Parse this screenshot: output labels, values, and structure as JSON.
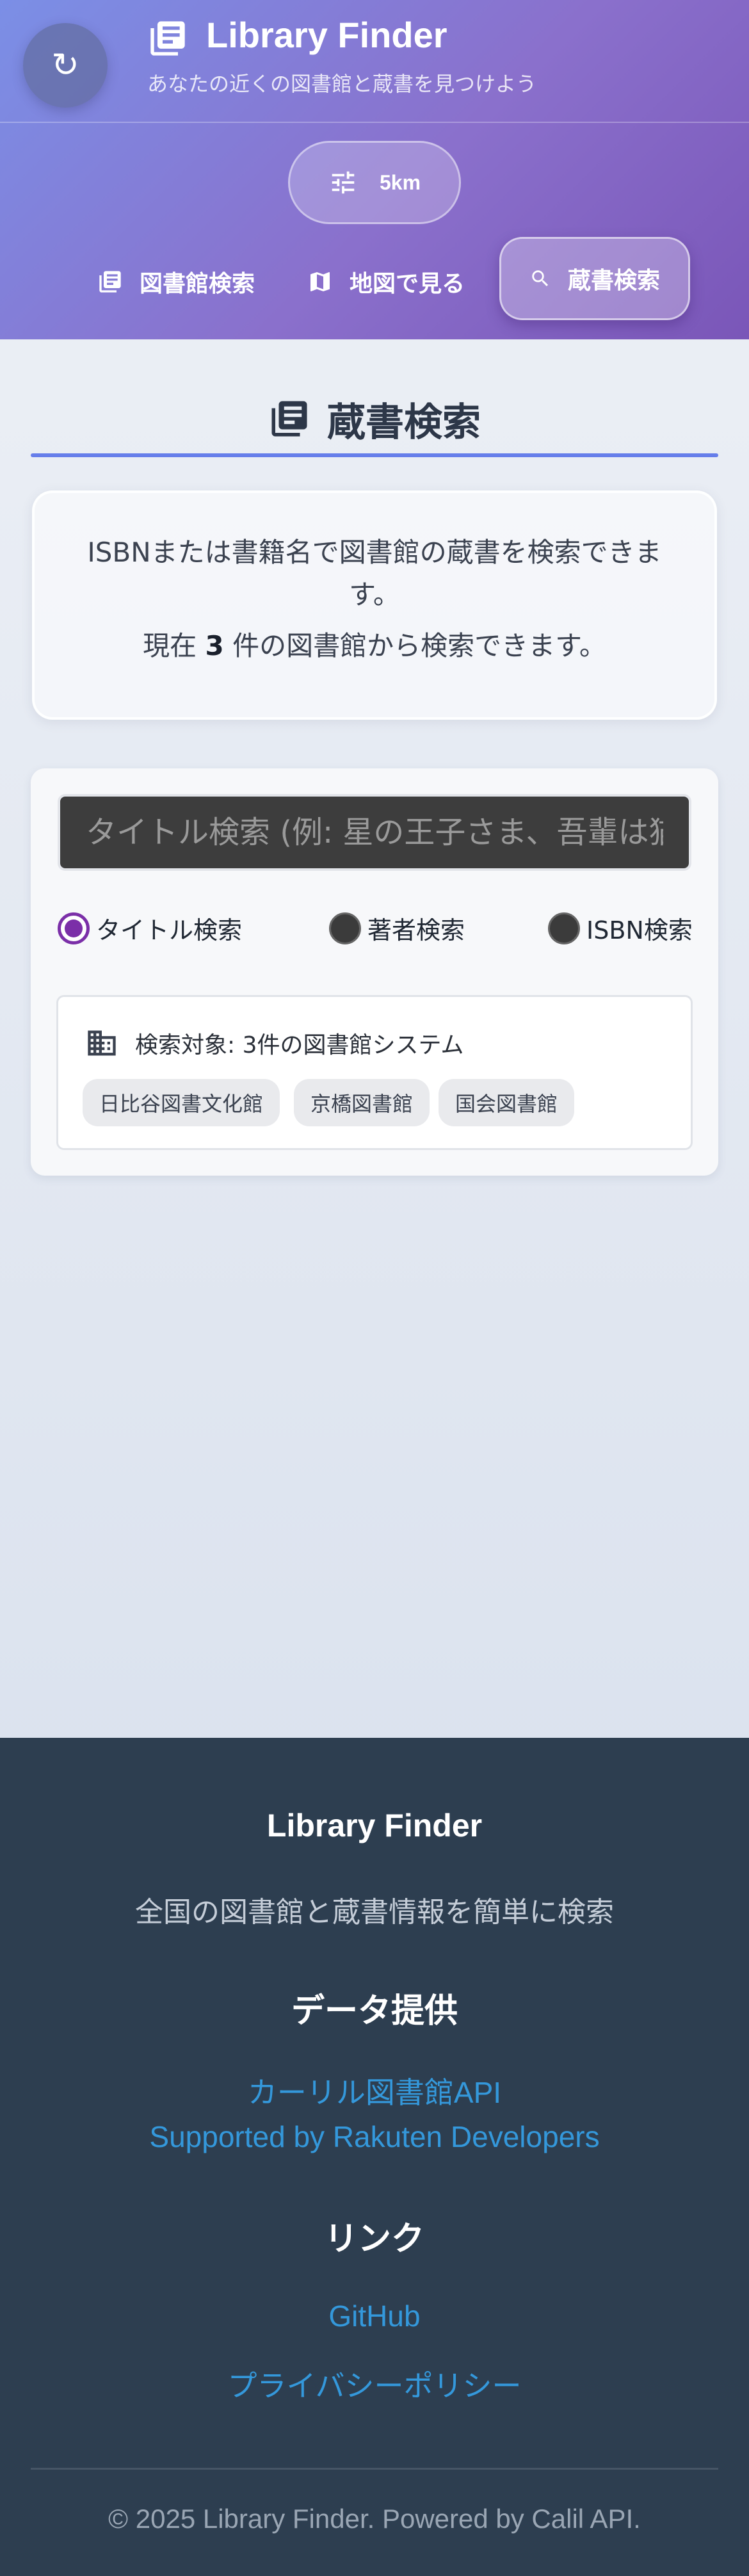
{
  "header": {
    "refresh_icon": "refresh-icon",
    "title": "Library Finder",
    "subtitle": "あなたの近くの図書館と蔵書を見つけよう",
    "radius_label": "5km",
    "nav": [
      {
        "label": "図書館検索",
        "icon": "book-icon"
      },
      {
        "label": "地図で見る",
        "icon": "map-icon"
      },
      {
        "label": "蔵書検索",
        "icon": "search-icon",
        "active": true
      }
    ]
  },
  "main": {
    "title": "蔵書検索",
    "info_line1": "ISBNまたは書籍名で図書館の蔵書を検索できます。",
    "info_prefix": "現在",
    "info_count": "3",
    "info_suffix": "件の図書館から検索できます。",
    "search": {
      "placeholder": "タイトル検索 (例: 星の王子さま、吾輩は猫である)",
      "value": ""
    },
    "search_modes": [
      {
        "label": "タイトル検索",
        "checked": true
      },
      {
        "label": "著者検索",
        "checked": false
      },
      {
        "label": "ISBN検索",
        "checked": false
      }
    ],
    "target": {
      "label": "検索対象: 3件の図書館システム",
      "libraries": [
        "日比谷図書文化館",
        "京橋図書館",
        "国会図書館"
      ]
    }
  },
  "footer": {
    "brand": "Library Finder",
    "description": "全国の図書館と蔵書情報を簡単に検索",
    "data_heading": "データ提供",
    "data_links": [
      "カーリル図書館API",
      "Supported by Rakuten Developers"
    ],
    "links_heading": "リンク",
    "links": [
      "GitHub",
      "プライバシーポリシー"
    ],
    "copyright": "© 2025 Library Finder. Powered by Calil API."
  },
  "colors": {
    "accent": "#667eea",
    "header_start": "#7b8fe6",
    "header_end": "#7a56b8",
    "radio_checked": "#7b2fa8",
    "footer_bg": "#2d3e50",
    "footer_link": "#3498db"
  }
}
